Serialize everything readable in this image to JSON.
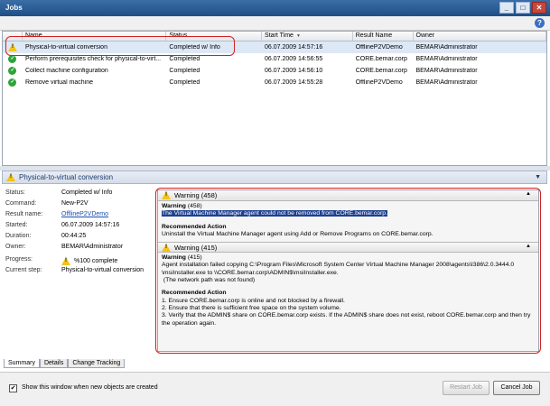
{
  "window": {
    "title": "Jobs",
    "minimize": "_",
    "maximize": "□",
    "close": "✕"
  },
  "help": "?",
  "grid": {
    "columns": [
      "Name",
      "Status",
      "Start Time",
      "Result Name",
      "Owner"
    ],
    "sort_indicator": "▼",
    "rows": [
      {
        "name": "Physical-to-virtual conversion",
        "status": "Completed w/ Info",
        "start": "06.07.2009 14:57:16",
        "result": "OfflineP2VDemo",
        "owner": "BEMAR\\Administrator",
        "state": "warning"
      },
      {
        "name": "Perform prerequisites check for physical-to-virt...",
        "status": "Completed",
        "start": "06.07.2009 14:56:55",
        "result": "CORE.bemar.corp",
        "owner": "BEMAR\\Administrator",
        "state": "ok"
      },
      {
        "name": "Collect machine configuration",
        "status": "Completed",
        "start": "06.07.2009 14:56:10",
        "result": "CORE.bemar.corp",
        "owner": "BEMAR\\Administrator",
        "state": "ok"
      },
      {
        "name": "Remove virtual machine",
        "status": "Completed",
        "start": "06.07.2009 14:55:28",
        "result": "OfflineP2VDemo",
        "owner": "BEMAR\\Administrator",
        "state": "ok"
      }
    ]
  },
  "detail": {
    "title": "Physical-to-virtual conversion",
    "collapse": "▼",
    "fields": {
      "status_label": "Status:",
      "status": "Completed w/ Info",
      "command_label": "Command:",
      "command": "New-P2V",
      "result_label": "Result name:",
      "result": "OfflineP2VDemo",
      "started_label": "Started:",
      "started": "06.07.2009 14:57:16",
      "duration_label": "Duration:",
      "duration": "00:44:25",
      "owner_label": "Owner:",
      "owner": "BEMAR\\Administrator",
      "progress_label": "Progress:",
      "progress": "%100 complete",
      "step_label": "Current step:",
      "step": "Physical-to-virtual conversion"
    },
    "warnings": [
      {
        "header": "Warning (458)",
        "collapse": "▲",
        "code": "Warning",
        "code_num": "(458)",
        "message": "The Virtual Machine Manager agent could not be removed from CORE.bemar.corp.",
        "action_title": "Recommended Action",
        "action_lines": [
          "Uninstall the Virtual Machine Manager agent using Add or Remove Programs on CORE.bemar.corp."
        ]
      },
      {
        "header": "Warning (415)",
        "collapse": "▲",
        "code": "Warning",
        "code_num": "(415)",
        "message_lines": [
          "Agent installation failed copying C:\\Program Files\\Microsoft System Center Virtual Machine Manager 2008\\agents\\I386\\2.0.3444.0",
          "\\msiInstaller.exe to \\\\CORE.bemar.corp\\ADMIN$\\msiInstaller.exe.",
          " (The network path was not found)"
        ],
        "action_title": "Recommended Action",
        "action_lines": [
          "1. Ensure CORE.bemar.corp is online and not blocked by a firewall.",
          "2. Ensure that there is sufficient free space on the system volume.",
          "3. Verify that the ADMIN$ share on CORE.bemar.corp exists. If the ADMIN$ share does not exist, reboot CORE.bemar.corp and then try",
          "the operation again."
        ]
      }
    ]
  },
  "tabs": [
    "Summary",
    "Details",
    "Change Tracking"
  ],
  "footer": {
    "checkbox_mark": "✔",
    "checkbox_label": "Show this window when new objects are created",
    "restart_label": "Restart Job",
    "cancel_label": "Cancel Job"
  }
}
